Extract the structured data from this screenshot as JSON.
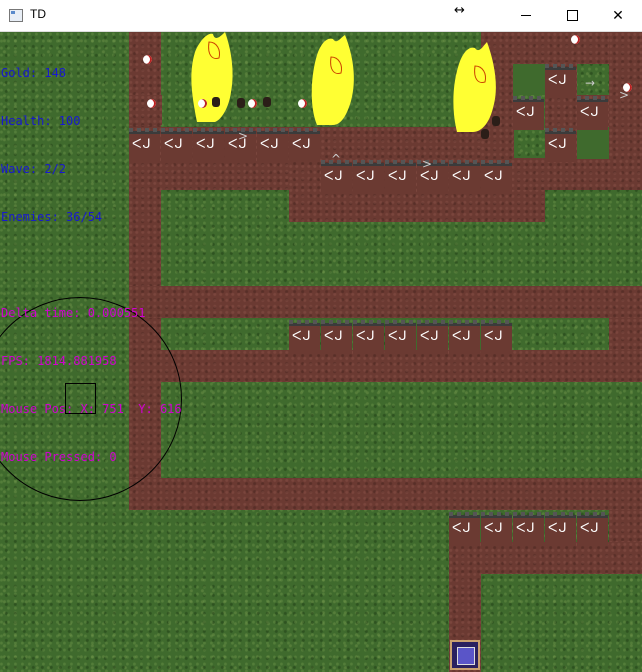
{
  "window": {
    "title": "TD",
    "resize_cursor": "↔",
    "buttons": {
      "close": "✕"
    }
  },
  "hud": {
    "gold": "Gold: 148",
    "health": "Health: 100",
    "wave": "Wave: 2/2",
    "enemies": "Enemies: 36/54",
    "delta_time": "Delta time: 0.000551",
    "fps": "FPS: 1814.881958",
    "mouse_pos": "Mouse Pos: X: 751  Y: 616",
    "mouse_pressed": "Mouse Pressed: 0",
    "colors": {
      "stats": "#1818d0",
      "debug": "#d000d0"
    }
  },
  "tower_glyph": "ᐸᒍ",
  "colors": {
    "grass": "#3f6a2d",
    "path": "#6b3a32",
    "boss": "#ffff33"
  }
}
